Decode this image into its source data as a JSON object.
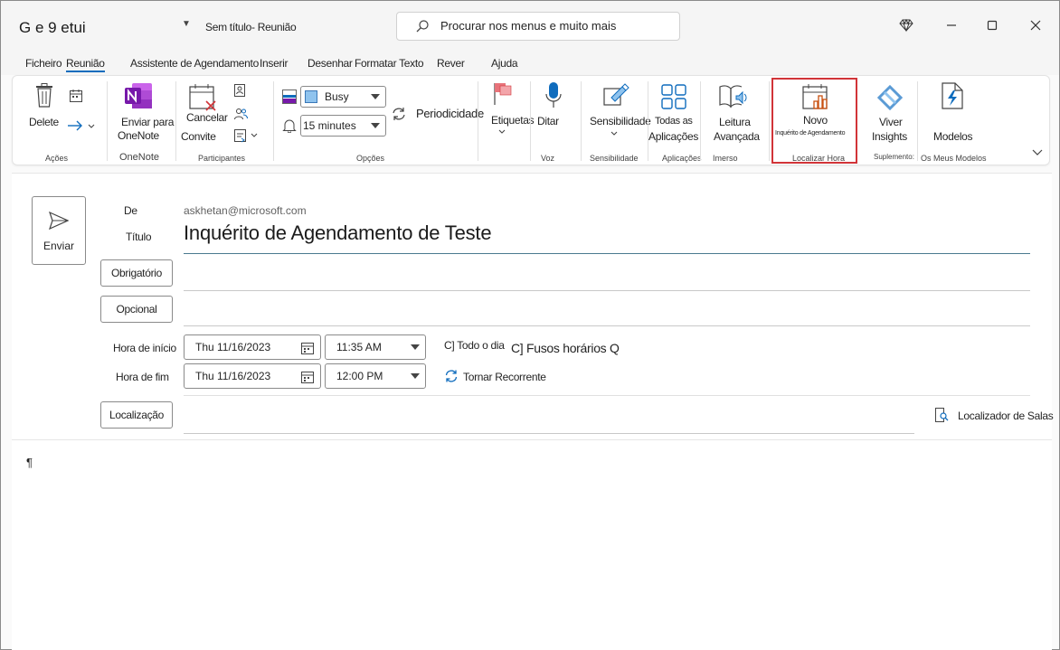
{
  "window": {
    "app_title": "G e 9 etui",
    "doc_title": "Sem título- Reunião",
    "search_placeholder": "Procurar nos menus e muito mais"
  },
  "tabs": [
    {
      "label": "Ficheiro"
    },
    {
      "label": "Reunião",
      "active": true
    },
    {
      "label": "Assistente de Agendamento"
    },
    {
      "label": "Inserir"
    },
    {
      "label": "Desenhar"
    },
    {
      "label": "Formatar Texto"
    },
    {
      "label": "Rever"
    },
    {
      "label": "Ajuda"
    }
  ],
  "ribbon": {
    "acoes": {
      "delete": "Delete",
      "group": "Ações"
    },
    "onenote": {
      "line1": "Enviar para",
      "line2": "OneNote",
      "group": "OneNote"
    },
    "participantes": {
      "cancel_line1": "Cancelar",
      "cancel_line2": "Convite",
      "group": "Participantes"
    },
    "opcoes": {
      "show_as": "Busy",
      "reminder": "15 minutes",
      "recurrence": "Periodicidade",
      "group": "Opções"
    },
    "etiquetas": {
      "label": "Etiquetas"
    },
    "voz": {
      "label": "Ditar",
      "group": "Voz"
    },
    "sensibilidade": {
      "label": "Sensibilidade",
      "group": "Sensibilidade"
    },
    "aplicacoes": {
      "line1": "Todas as",
      "line2": "Aplicações",
      "group": "Aplicações"
    },
    "imerso": {
      "line1": "Leitura",
      "line2": "Avançada",
      "group": "Imerso"
    },
    "localizar_hora": {
      "line1": "Novo",
      "line2": "Inquérito de Agendamento",
      "group": "Localizar Hora"
    },
    "suplementos": {
      "line1": "Viver",
      "line2": "Insights",
      "group": "Suplemento:"
    },
    "modelos": {
      "label": "Modelos",
      "group": "Os Meus Modelos"
    }
  },
  "compose": {
    "send_label": "Enviar",
    "from_label": "De",
    "from_value": "askhetan@microsoft.com",
    "title_label": "Título",
    "title_value": "Inquérito de Agendamento de Teste",
    "required_label": "Obrigatório",
    "optional_label": "Opcional",
    "start_label": "Hora de início",
    "start_date": "Thu 11/16/2023",
    "start_time": "11:35 AM",
    "end_label": "Hora de fim",
    "end_date": "Thu 11/16/2023",
    "end_time": "12:00 PM",
    "all_day": "C] Todo o dia",
    "time_zones": "C] Fusos horários Q",
    "recurrence": "Tornar Recorrente",
    "location_label": "Localização",
    "room_finder": "Localizador de Salas",
    "body_mark": "¶"
  },
  "colors": {
    "accent": "#0f6cbd",
    "highlight": "#d13438",
    "onenote": "#7719aa"
  }
}
